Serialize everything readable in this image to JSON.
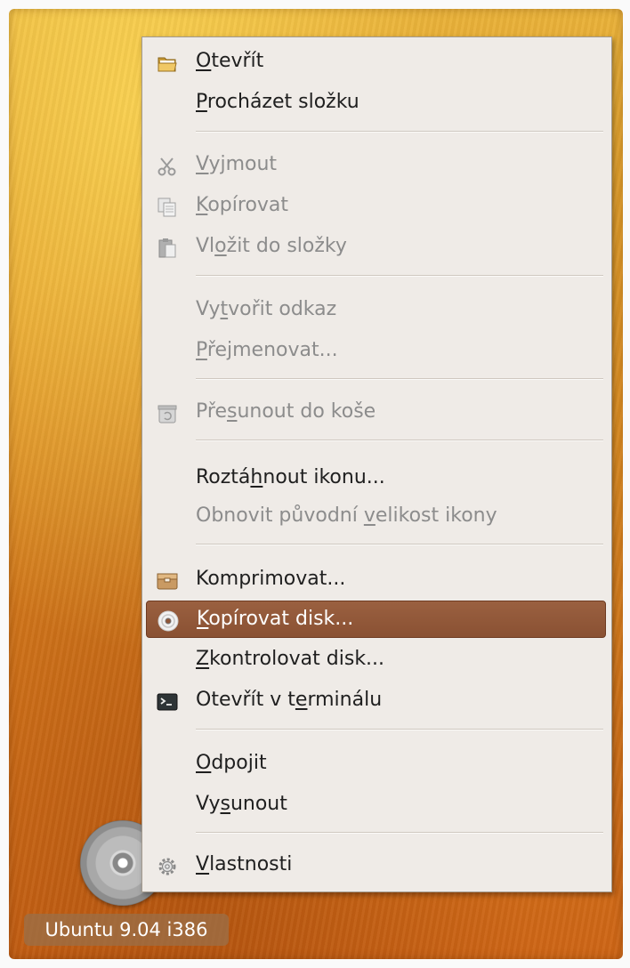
{
  "desktop": {
    "drive_label": "Ubuntu 9.04 i386"
  },
  "menu": {
    "items": [
      {
        "key": "open",
        "pre": "",
        "u": "O",
        "post": "tevřít",
        "icon": "folder-open-icon",
        "disabled": false
      },
      {
        "key": "browse",
        "pre": "",
        "u": "P",
        "post": "rocházet složku",
        "icon": null,
        "disabled": false
      },
      {
        "key": "cut",
        "pre": "",
        "u": "V",
        "post": "yjmout",
        "icon": "scissors-icon",
        "disabled": true
      },
      {
        "key": "copy",
        "pre": "",
        "u": "K",
        "post": "opírovat",
        "icon": "copy-icon",
        "disabled": true
      },
      {
        "key": "paste",
        "pre": "Vl",
        "u": "o",
        "post": "žit do složky",
        "icon": "paste-icon",
        "disabled": true
      },
      {
        "key": "make-link",
        "pre": "Vy",
        "u": "t",
        "post": "vořit odkaz",
        "icon": null,
        "disabled": true
      },
      {
        "key": "rename",
        "pre": "",
        "u": "P",
        "post": "řejmenovat...",
        "icon": null,
        "disabled": true
      },
      {
        "key": "trash",
        "pre": "Pře",
        "u": "s",
        "post": "unout do koše",
        "icon": "trash-icon",
        "disabled": true
      },
      {
        "key": "stretch",
        "pre": "Roztá",
        "u": "h",
        "post": "nout ikonu...",
        "icon": null,
        "disabled": false
      },
      {
        "key": "restore-size",
        "pre": "Obnovit původní ",
        "u": "v",
        "post": "elikost ikony",
        "icon": null,
        "disabled": true
      },
      {
        "key": "compress",
        "pre": "Komprimovat...",
        "u": "",
        "post": "",
        "icon": "archive-icon",
        "disabled": false
      },
      {
        "key": "copy-disc",
        "pre": "",
        "u": "K",
        "post": "opírovat disk...",
        "icon": "disc-icon",
        "disabled": false,
        "highlighted": true
      },
      {
        "key": "check-disk",
        "pre": "",
        "u": "Z",
        "post": "kontrolovat disk...",
        "icon": null,
        "disabled": false
      },
      {
        "key": "open-terminal",
        "pre": "Otevřít v t",
        "u": "e",
        "post": "rminálu",
        "icon": "terminal-icon",
        "disabled": false
      },
      {
        "key": "unmount",
        "pre": "",
        "u": "O",
        "post": "dpojit",
        "icon": null,
        "disabled": false
      },
      {
        "key": "eject",
        "pre": "Vy",
        "u": "s",
        "post": "unout",
        "icon": null,
        "disabled": false
      },
      {
        "key": "properties",
        "pre": "",
        "u": "V",
        "post": "lastnosti",
        "icon": "gear-icon",
        "disabled": false
      }
    ]
  },
  "colors": {
    "menu_bg": "#efebe7",
    "highlight": "#8f5638",
    "disabled_text": "#8c8c8c",
    "desktop_orange": "#df8f24"
  }
}
